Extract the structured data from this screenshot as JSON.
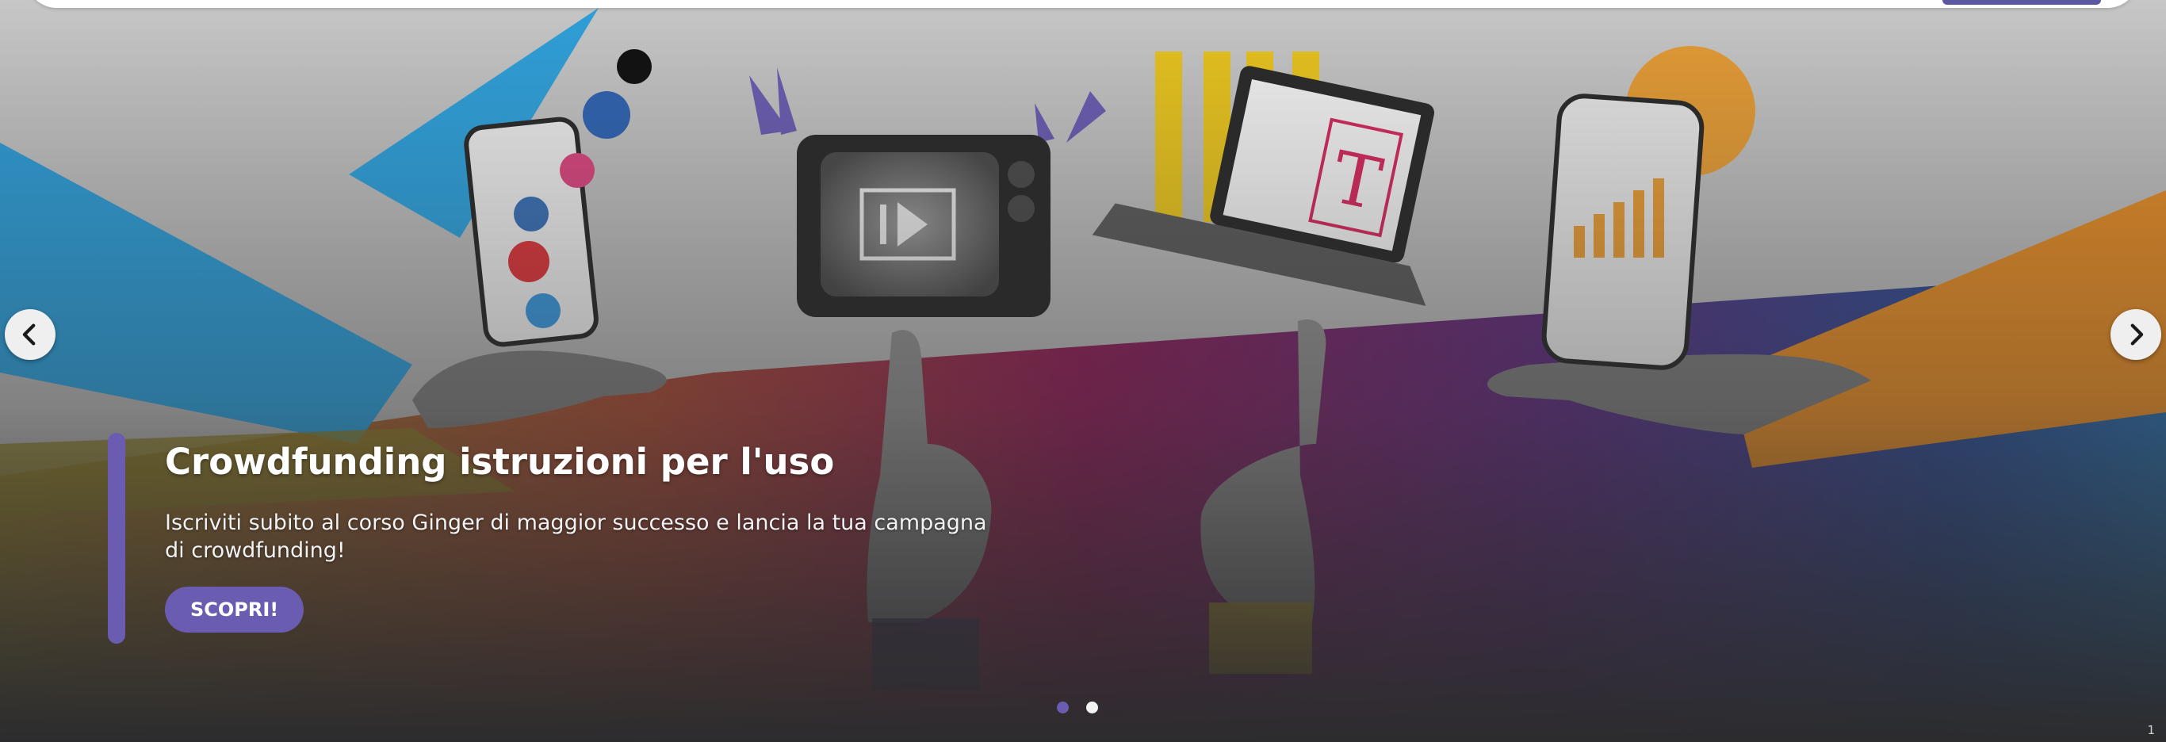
{
  "slide": {
    "title": "Crowdfunding istruzioni per l'uso",
    "description": "Iscriviti subito al corso Ginger di maggior successo e lancia la tua campagna di crowdfunding!",
    "cta_label": "SCOPRI!"
  },
  "carousel": {
    "slide_count": 2,
    "active_slide": 1,
    "prev_icon": "chevron-left-icon",
    "next_icon": "chevron-right-icon"
  },
  "page_number": "1",
  "colors": {
    "accent": "#6a5cb0",
    "footer_bg": "#2c2c2e",
    "blue_triangle": "#2f9fd8",
    "yellow": "#e8c72a",
    "orange": "#e3932a"
  }
}
